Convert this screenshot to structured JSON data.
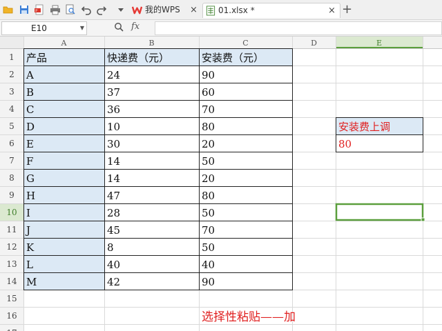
{
  "toolbar": {
    "icons": [
      "folder-open-icon",
      "save-icon",
      "export-pdf-icon",
      "print-icon",
      "print-preview-icon",
      "undo-icon",
      "redo-icon",
      "more-dropdown-icon"
    ]
  },
  "tabs": [
    {
      "label": "我的WPS",
      "icon": "wps-logo-icon",
      "close": "×"
    },
    {
      "label": "01.xlsx *",
      "icon": "spreadsheet-file-icon",
      "close": "×"
    }
  ],
  "new_tab": "+",
  "formula_bar": {
    "cell_ref": "E10",
    "fx_label": "fx",
    "formula": ""
  },
  "columns": [
    "A",
    "B",
    "C",
    "D",
    "E"
  ],
  "selected_column": "E",
  "rows": [
    "1",
    "2",
    "3",
    "4",
    "5",
    "6",
    "7",
    "8",
    "9",
    "10",
    "11",
    "12",
    "13",
    "14",
    "15",
    "16",
    "17"
  ],
  "selected_row": "10",
  "table": {
    "headers": [
      "产品",
      "快递费（元）",
      "安装费（元）"
    ],
    "data": [
      [
        "A",
        "24",
        "90"
      ],
      [
        "B",
        "37",
        "60"
      ],
      [
        "C",
        "36",
        "70"
      ],
      [
        "D",
        "10",
        "80"
      ],
      [
        "E",
        "30",
        "20"
      ],
      [
        "F",
        "14",
        "50"
      ],
      [
        "G",
        "14",
        "20"
      ],
      [
        "H",
        "47",
        "80"
      ],
      [
        "I",
        "28",
        "50"
      ],
      [
        "J",
        "45",
        "70"
      ],
      [
        "K",
        "8",
        "50"
      ],
      [
        "L",
        "40",
        "40"
      ],
      [
        "M",
        "42",
        "90"
      ]
    ]
  },
  "side_box": {
    "label": "安装费上调",
    "value": "80"
  },
  "annotation": "选择性粘贴——加",
  "colors": {
    "accent_red": "#e02020",
    "header_fill": "#dce9f5",
    "selection_green": "#5a9e3c",
    "wps_red": "#e53935"
  }
}
